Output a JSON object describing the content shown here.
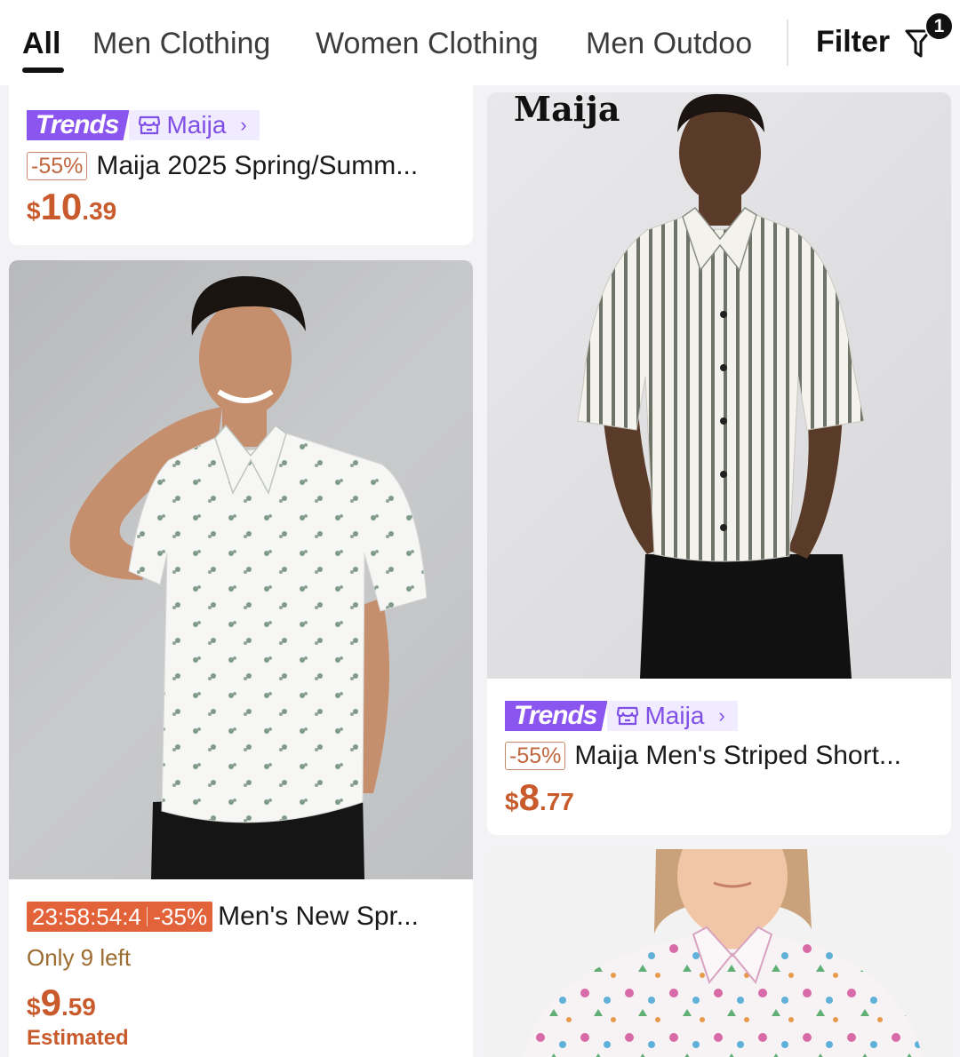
{
  "tabs": {
    "items": [
      "All",
      "Men Clothing",
      "Women Clothing",
      "Men Outdoo"
    ],
    "active": "All",
    "filter_label": "Filter",
    "filter_count": "1"
  },
  "products": [
    {
      "trends_label": "Trends",
      "store": "Maija",
      "discount": "-55%",
      "title": "Maija 2025 Spring/Summ...",
      "price_currency": "$",
      "price_whole": "10",
      "price_cents": ".39"
    },
    {
      "brand_watermark": "Maija",
      "trends_label": "Trends",
      "store": "Maija",
      "discount": "-55%",
      "title": "Maija Men's Striped Short...",
      "price_currency": "$",
      "price_whole": "8",
      "price_cents": ".77"
    },
    {
      "countdown": "23:58:54:4",
      "discount": "-35%",
      "title": "Men's New Spr...",
      "stock": "Only 9 left",
      "price_currency": "$",
      "price_whole": "9",
      "price_cents": ".59",
      "price_note": "Estimated"
    },
    {
      "title": ""
    }
  ],
  "colors": {
    "price": "#c85a2c",
    "trends": "#8b56f0",
    "store_bg": "#f1ebff",
    "countdown": "#e2623a"
  }
}
